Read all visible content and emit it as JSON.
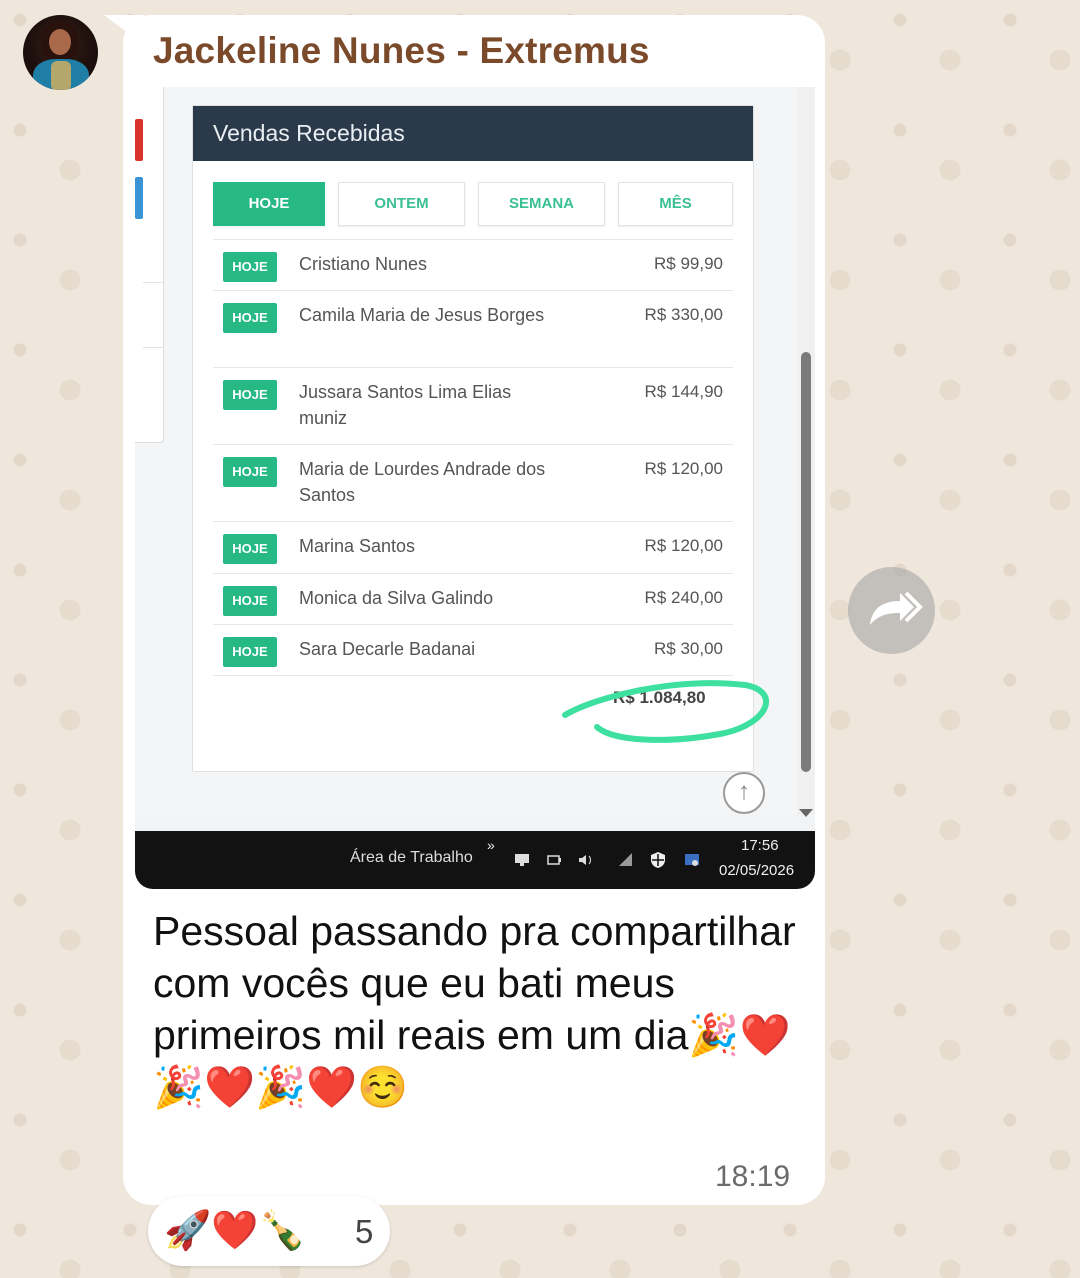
{
  "chat": {
    "sender": "Jackeline Nunes - Extremus",
    "message": "Pessoal passando pra compartilhar com vocês que eu bati meus primeiros mil reais em um dia",
    "message_emojis": "🎉❤️🎉❤️🎉❤️☺️",
    "time": "18:19",
    "reactions": "🚀❤️🍾",
    "reaction_count": "5"
  },
  "screenshot": {
    "panel_title": "Vendas Recebidas",
    "tabs": [
      {
        "label": "HOJE",
        "active": true
      },
      {
        "label": "ONTEM",
        "active": false
      },
      {
        "label": "SEMANA",
        "active": false
      },
      {
        "label": "MÊS",
        "active": false
      }
    ],
    "sales": [
      {
        "badge": "HOJE",
        "name": "Cristiano Nunes",
        "value": "R$ 99,90"
      },
      {
        "badge": "HOJE",
        "name": "Camila Maria de Jesus Borges",
        "value": "R$ 330,00"
      },
      {
        "badge": "HOJE",
        "name": "Jussara Santos Lima Elias muniz",
        "value": "R$ 144,90"
      },
      {
        "badge": "HOJE",
        "name": "Maria de Lourdes Andrade dos Santos",
        "value": "R$ 120,00"
      },
      {
        "badge": "HOJE",
        "name": "Marina Santos",
        "value": "R$ 120,00"
      },
      {
        "badge": "HOJE",
        "name": "Monica da Silva Galindo",
        "value": "R$ 240,00"
      },
      {
        "badge": "HOJE",
        "name": "Sara Decarle Badanai",
        "value": "R$ 30,00"
      }
    ],
    "total": "R$ 1.084,80",
    "taskbar": {
      "label": "Área de Trabalho",
      "chevron": "»",
      "time": "17:56",
      "date": "02/05/2026"
    },
    "accent": "#26b985",
    "header_color": "#2b3a4a"
  },
  "icons": [
    "avatar",
    "forward-icon",
    "scroll-up-icon",
    "network-icon",
    "battery-icon",
    "volume-icon",
    "wifi-icon",
    "shield-icon",
    "sync-icon"
  ]
}
